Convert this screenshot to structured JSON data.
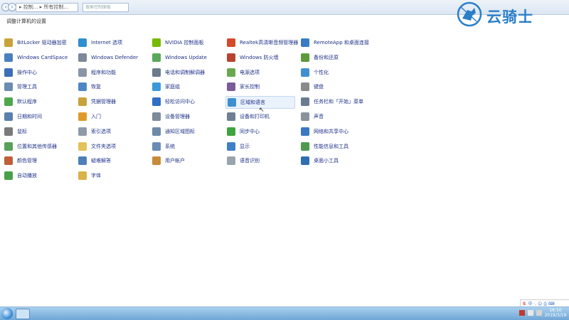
{
  "addressbar": {
    "crumbs": "▸ 控制... ▸ 所有控制...",
    "search_placeholder": "搜索控制面板"
  },
  "brand": {
    "logo_text": "云骑士"
  },
  "page": {
    "title": "调整计算机的设置"
  },
  "items": [
    {
      "label": "BitLocker 驱动器加密",
      "icon": "bitlocker-icon",
      "color": "#c9a23a"
    },
    {
      "label": "Internet 选项",
      "icon": "internet-options-icon",
      "color": "#2f8fd1"
    },
    {
      "label": "NVIDIA 控制面板",
      "icon": "nvidia-icon",
      "color": "#76b900"
    },
    {
      "label": "Realtek高清晰音频管理器",
      "icon": "realtek-audio-icon",
      "color": "#d34b2a"
    },
    {
      "label": "RemoteApp 和桌面连接",
      "icon": "remoteapp-icon",
      "color": "#3a7bc8"
    },
    {
      "label": "Windows CardSpace",
      "icon": "cardspace-icon",
      "color": "#4a7fc0"
    },
    {
      "label": "Windows Defender",
      "icon": "defender-icon",
      "color": "#7c8a9a"
    },
    {
      "label": "Windows Update",
      "icon": "windows-update-icon",
      "color": "#5aa85a"
    },
    {
      "label": "Windows 防火墙",
      "icon": "firewall-icon",
      "color": "#b8442e"
    },
    {
      "label": "备份和还原",
      "icon": "backup-icon",
      "color": "#5c9a3c"
    },
    {
      "label": "操作中心",
      "icon": "action-center-icon",
      "color": "#3b6fb6"
    },
    {
      "label": "程序和功能",
      "icon": "programs-icon",
      "color": "#8a96a6"
    },
    {
      "label": "电话和调制解调器",
      "icon": "phone-modem-icon",
      "color": "#6b7b8c"
    },
    {
      "label": "电源选项",
      "icon": "power-options-icon",
      "color": "#6aa84f"
    },
    {
      "label": "个性化",
      "icon": "personalization-icon",
      "color": "#3f8fd1"
    },
    {
      "label": "管理工具",
      "icon": "admin-tools-icon",
      "color": "#6b8bb0"
    },
    {
      "label": "恢复",
      "icon": "recovery-icon",
      "color": "#4f86c6"
    },
    {
      "label": "家庭组",
      "icon": "homegroup-icon",
      "color": "#3a9ad9"
    },
    {
      "label": "家长控制",
      "icon": "parental-controls-icon",
      "color": "#7a5c9a"
    },
    {
      "label": "键盘",
      "icon": "keyboard-icon",
      "color": "#8a8a8a"
    },
    {
      "label": "默认程序",
      "icon": "default-programs-icon",
      "color": "#4da84d"
    },
    {
      "label": "凭据管理器",
      "icon": "credential-manager-icon",
      "color": "#c8a23c"
    },
    {
      "label": "轻松访问中心",
      "icon": "ease-of-access-icon",
      "color": "#2f6fc4"
    },
    {
      "label": "区域和语言",
      "icon": "region-language-icon",
      "color": "#3d8fd0"
    },
    {
      "label": "任务栏和「开始」菜单",
      "icon": "taskbar-icon",
      "color": "#6a7c92"
    },
    {
      "label": "日期和时间",
      "icon": "date-time-icon",
      "color": "#5b7fae"
    },
    {
      "label": "入门",
      "icon": "getting-started-icon",
      "color": "#e09a2a"
    },
    {
      "label": "设备管理器",
      "icon": "device-manager-icon",
      "color": "#7d8b9b"
    },
    {
      "label": "设备和打印机",
      "icon": "devices-printers-icon",
      "color": "#6f8094"
    },
    {
      "label": "声音",
      "icon": "sound-icon",
      "color": "#8a939c"
    },
    {
      "label": "鼠标",
      "icon": "mouse-icon",
      "color": "#7a7a7a"
    },
    {
      "label": "索引选项",
      "icon": "indexing-icon",
      "color": "#8f9aa8"
    },
    {
      "label": "通知区域图标",
      "icon": "notification-icons-icon",
      "color": "#6e8aa8"
    },
    {
      "label": "同步中心",
      "icon": "sync-center-icon",
      "color": "#3fa33f"
    },
    {
      "label": "网络和共享中心",
      "icon": "network-sharing-icon",
      "color": "#3a78c0"
    },
    {
      "label": "位置和其他传感器",
      "icon": "location-sensors-icon",
      "color": "#5aa05a"
    },
    {
      "label": "文件夹选项",
      "icon": "folder-options-icon",
      "color": "#e3c25a"
    },
    {
      "label": "系统",
      "icon": "system-icon",
      "color": "#6a8db3"
    },
    {
      "label": "显示",
      "icon": "display-icon",
      "color": "#3f7fc6"
    },
    {
      "label": "性能信息和工具",
      "icon": "performance-icon",
      "color": "#4f9a4f"
    },
    {
      "label": "颜色管理",
      "icon": "color-management-icon",
      "color": "#c0603a"
    },
    {
      "label": "疑难解答",
      "icon": "troubleshooting-icon",
      "color": "#4f7fb8"
    },
    {
      "label": "用户帐户",
      "icon": "user-accounts-icon",
      "color": "#c98a3a"
    },
    {
      "label": "语音识别",
      "icon": "speech-recognition-icon",
      "color": "#9aa4ae"
    },
    {
      "label": "桌面小工具",
      "icon": "gadgets-icon",
      "color": "#2f6fb0"
    },
    {
      "label": "自动播放",
      "icon": "autoplay-icon",
      "color": "#4aa04a"
    },
    {
      "label": "字体",
      "icon": "fonts-icon",
      "color": "#d9b24a"
    }
  ],
  "selected_item": "区域和语言",
  "tray": {
    "ime_text": "中 ·, ☺ ⎙ ⌨",
    "time": "16:10",
    "date": "2019/3/19"
  }
}
